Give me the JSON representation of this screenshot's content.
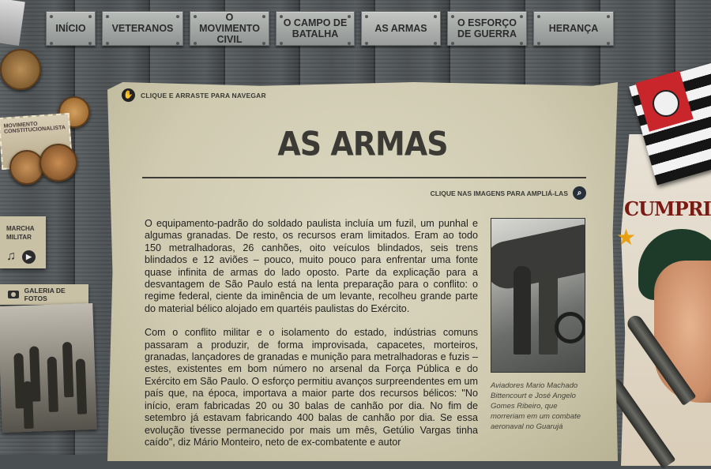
{
  "nav": {
    "items": [
      {
        "label": "INÍCIO"
      },
      {
        "label": "VETERANOS"
      },
      {
        "label": "O MOVIMENTO CIVIL"
      },
      {
        "label": "O CAMPO DE BATALHA"
      },
      {
        "label": "AS ARMAS"
      },
      {
        "label": "O ESFORÇO DE GUERRA"
      },
      {
        "label": "HERANÇA"
      }
    ],
    "active": "AS ARMAS"
  },
  "hints": {
    "drag": "CLIQUE E  ARRASTE PARA NAVEGAR",
    "zoom": "CLIQUE NAS IMAGENS PARA AMPLIÁ-LAS"
  },
  "article": {
    "title": "AS ARMAS",
    "paragraphs": [
      "O equipamento-padrão do soldado paulista incluía um fuzil, um punhal e algumas granadas. De resto, os recursos eram limitados.  Eram ao todo 150 metralhadoras, 26 canhões, oito veículos blindados, seis trens blindados e 12 aviões – pouco, muito pouco para enfrentar uma fonte quase infinita de armas do lado oposto. Parte da explicação para a desvantagem de São Paulo está na lenta preparação para o conflito: o regime federal, ciente da iminência de um levante, recolheu grande parte do material bélico alojado em quartéis paulistas do Exército.",
      "Com o conflito militar e o isolamento do estado, indústrias comuns passaram a produzir, de forma improvisada, capacetes, morteiros, granadas, lançadores de granadas e munição para metralhadoras e fuzis – estes, existentes em bom número no arsenal da Força Pública e do Exército em São Paulo. O esforço permitiu avanços surpreendentes em um país que, na época, importava a maior parte dos recursos bélicos: \"No início, eram fabricadas 20 ou 30 balas de canhão por dia. No fim de setembro já estavam fabricando 400 balas de canhão por dia. Se essa evolução tivesse permanecido por mais um mês, Getúlio Vargas tinha caído\", diz Mário Monteiro, neto de ex-combatente e autor"
    ],
    "photo_caption": "Aviadores Mario Machado Bittencourt e José Angelo Gomes Ribeiro, que morreriam em um combate aeronaval no Guarujá"
  },
  "sidebar": {
    "music_label": "MARCHA MILITAR",
    "gallery_label": "GALERIA DE FOTOS",
    "stamp_text": "MOVIMENTO CONSTITUCIONALISTA"
  },
  "poster": {
    "text": "CUMPRIR"
  },
  "icons": {
    "drag": "hand-icon",
    "zoom": "search-icon",
    "music": "music-note-icon",
    "play": "play-icon",
    "gallery": "camera-icon"
  },
  "colors": {
    "paper": "#d3cfb7",
    "text": "#232220",
    "nav_button": "#a3a6a4",
    "flag_red": "#c8262a"
  }
}
